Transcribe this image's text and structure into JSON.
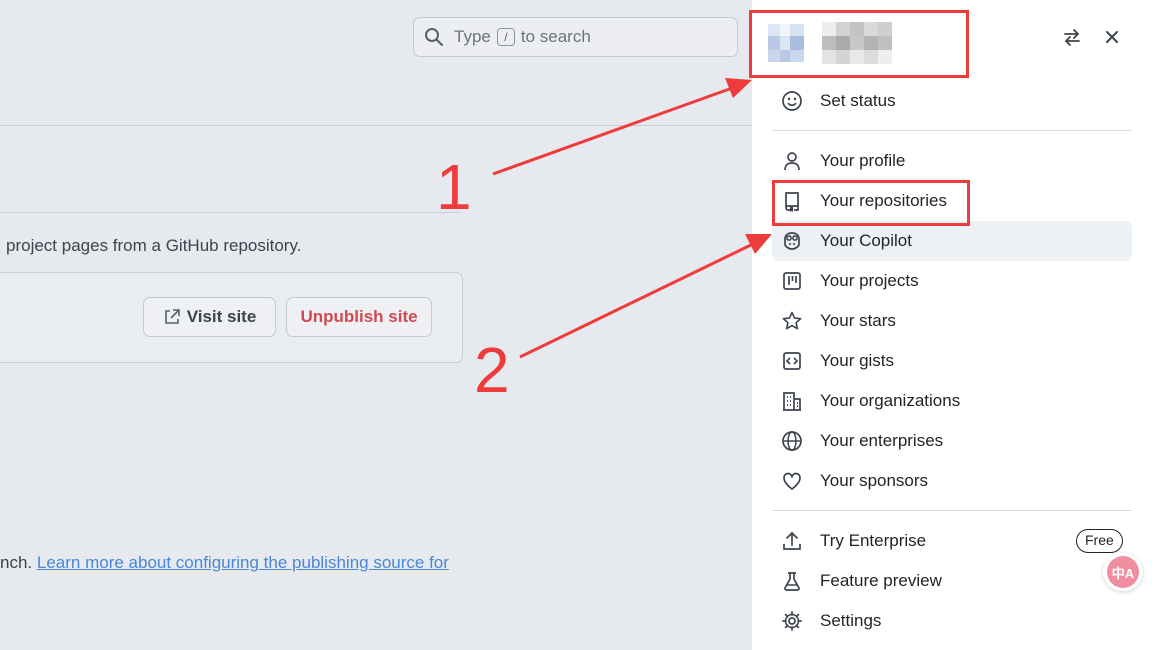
{
  "search": {
    "prefix": "Type",
    "key": "/",
    "suffix": "to search"
  },
  "pages": {
    "description": "project pages from a GitHub repository.",
    "visit_label": "Visit site",
    "unpublish_label": "Unpublish site",
    "bottom_prefix": "nch.",
    "bottom_link": "Learn more about configuring the publishing source for"
  },
  "menu": {
    "set_status": "Set status",
    "items": [
      {
        "label": "Your profile",
        "icon": "person-icon"
      },
      {
        "label": "Your repositories",
        "icon": "repo-icon"
      },
      {
        "label": "Your Copilot",
        "icon": "copilot-icon"
      },
      {
        "label": "Your projects",
        "icon": "project-icon"
      },
      {
        "label": "Your stars",
        "icon": "star-icon"
      },
      {
        "label": "Your gists",
        "icon": "code-square-icon"
      },
      {
        "label": "Your organizations",
        "icon": "organization-icon"
      },
      {
        "label": "Your enterprises",
        "icon": "globe-icon"
      },
      {
        "label": "Your sponsors",
        "icon": "heart-icon"
      }
    ],
    "footer": [
      {
        "label": "Try Enterprise",
        "icon": "upload-icon",
        "badge": "Free"
      },
      {
        "label": "Feature preview",
        "icon": "beaker-icon"
      },
      {
        "label": "Settings",
        "icon": "gear-icon"
      }
    ]
  },
  "annotations": {
    "label_1": "1",
    "label_2": "2",
    "color": "#ee3b3b"
  },
  "translate_glyph": "中A"
}
